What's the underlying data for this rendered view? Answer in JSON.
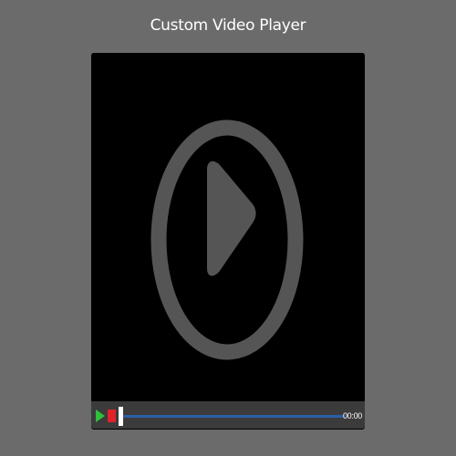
{
  "page": {
    "title": "Custom Video Player"
  },
  "player": {
    "overlay_icon": "play-circle-icon",
    "controls": {
      "play_icon": "play-icon",
      "stop_icon": "stop-icon",
      "progress": 0,
      "time": "00:00"
    },
    "colors": {
      "background": "#6b6b6b",
      "video": "#000000",
      "overlay": "#555555",
      "controls_bar": "#3b3b3b",
      "play": "#2fbf3a",
      "stop": "#e0222a",
      "progress_track": "#2a5fa8",
      "handle": "#ffffff"
    }
  }
}
